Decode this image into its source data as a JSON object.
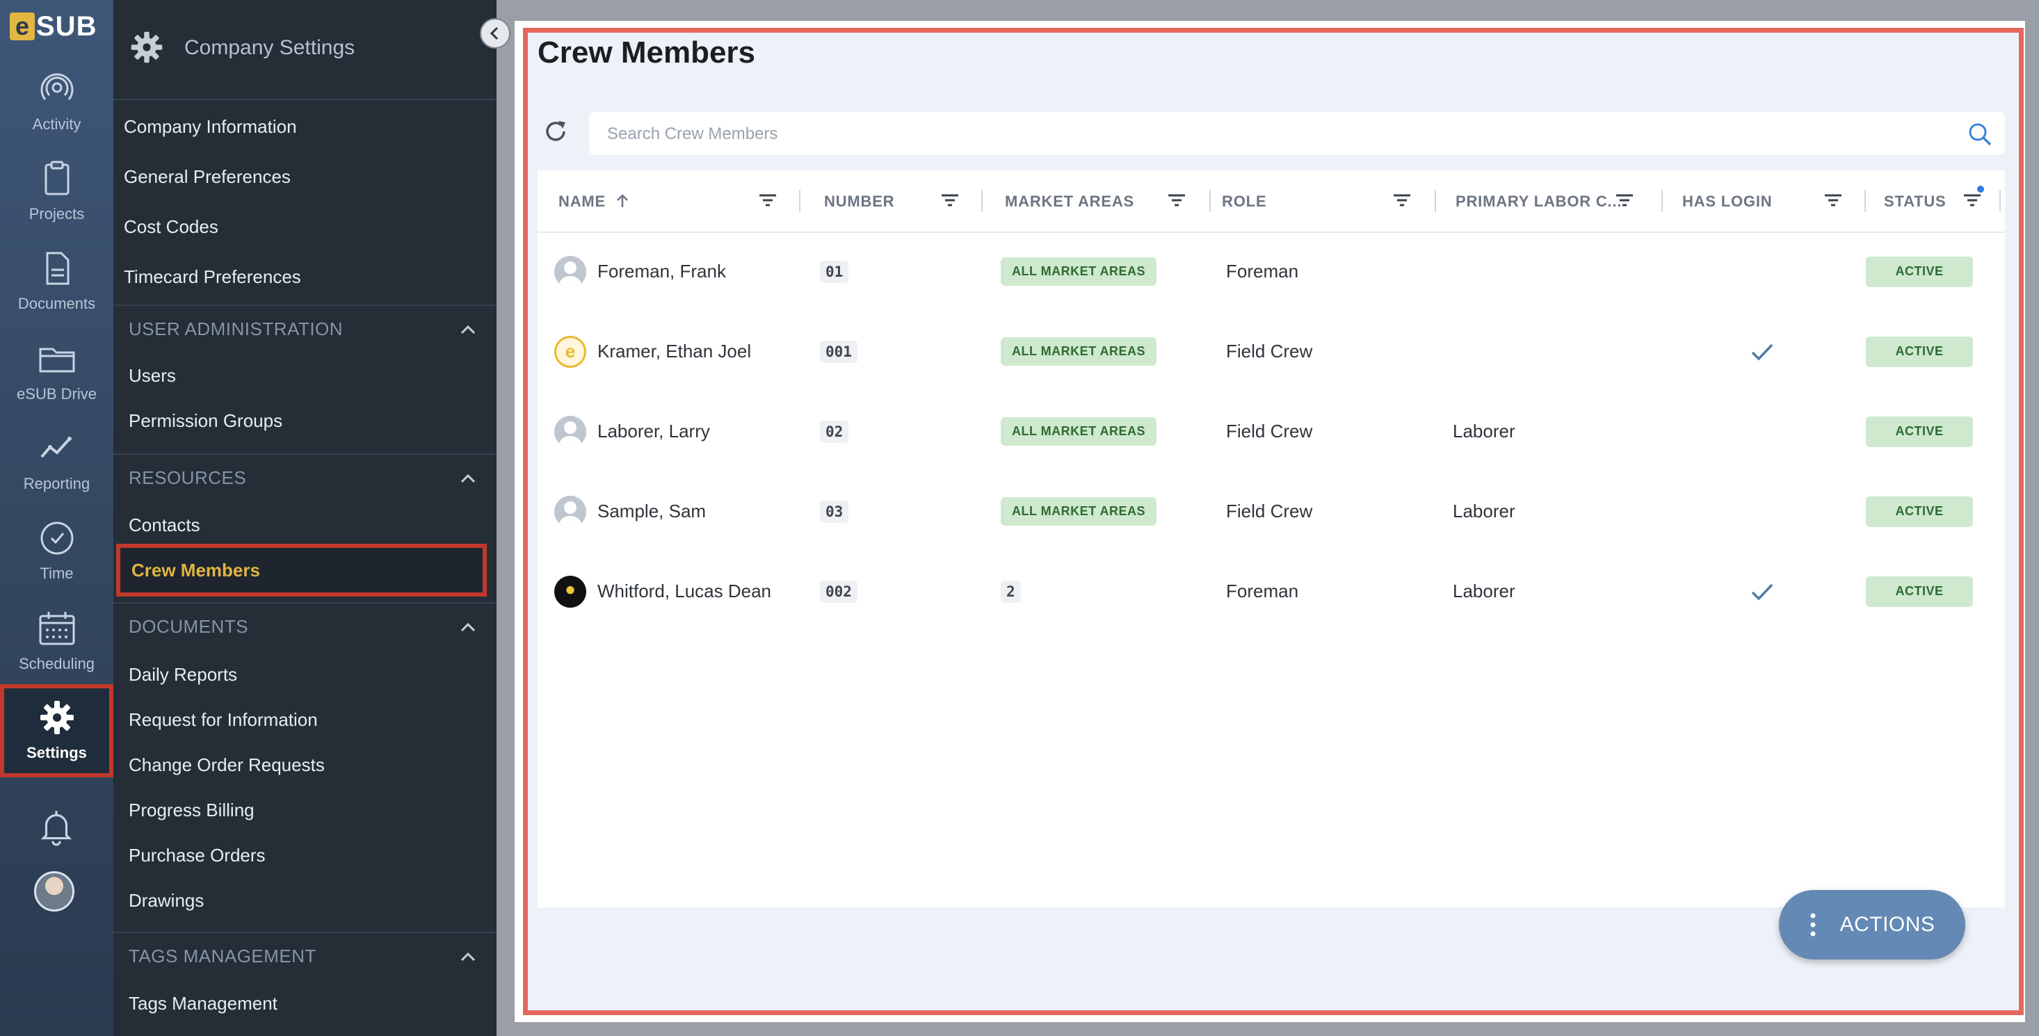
{
  "brand": {
    "logo_letter": "e",
    "logo_rest": "SUB"
  },
  "rail": {
    "items": [
      {
        "label": "Activity",
        "icon": "activity-icon"
      },
      {
        "label": "Projects",
        "icon": "clipboard-icon"
      },
      {
        "label": "Documents",
        "icon": "document-icon"
      },
      {
        "label": "eSUB Drive",
        "icon": "folder-icon"
      },
      {
        "label": "Reporting",
        "icon": "chart-icon"
      },
      {
        "label": "Time",
        "icon": "clock-icon"
      },
      {
        "label": "Scheduling",
        "icon": "calendar-icon"
      },
      {
        "label": "Settings",
        "icon": "gear-icon"
      }
    ],
    "active": "Settings"
  },
  "panel": {
    "title": "Company Settings",
    "top_links": [
      "Company Information",
      "General Preferences",
      "Cost Codes",
      "Timecard Preferences"
    ],
    "sections": [
      {
        "title": "USER ADMINISTRATION",
        "items": [
          "Users",
          "Permission Groups"
        ]
      },
      {
        "title": "RESOURCES",
        "items": [
          "Contacts",
          "Crew Members"
        ]
      },
      {
        "title": "DOCUMENTS",
        "items": [
          "Daily Reports",
          "Request for Information",
          "Change Order Requests",
          "Progress Billing",
          "Purchase Orders",
          "Drawings"
        ]
      },
      {
        "title": "TAGS MANAGEMENT",
        "items": [
          "Tags Management"
        ]
      }
    ],
    "active_item": "Crew Members"
  },
  "main": {
    "title": "Crew Members",
    "search_placeholder": "Search Crew Members",
    "columns": [
      "NAME",
      "NUMBER",
      "MARKET AREAS",
      "ROLE",
      "PRIMARY LABOR C...",
      "HAS LOGIN",
      "STATUS"
    ],
    "rows": [
      {
        "name": "Foreman, Frank",
        "number": "01",
        "market_areas": "ALL MARKET AREAS",
        "role": "Foreman",
        "labor": "",
        "has_login": false,
        "status": "ACTIVE",
        "avatar": "generic"
      },
      {
        "name": "Kramer, Ethan Joel",
        "number": "001",
        "market_areas": "ALL MARKET AREAS",
        "role": "Field Crew",
        "labor": "",
        "has_login": true,
        "status": "ACTIVE",
        "avatar": "esub"
      },
      {
        "name": "Laborer, Larry",
        "number": "02",
        "market_areas": "ALL MARKET AREAS",
        "role": "Field Crew",
        "labor": "Laborer",
        "has_login": false,
        "status": "ACTIVE",
        "avatar": "generic"
      },
      {
        "name": "Sample, Sam",
        "number": "03",
        "market_areas": "ALL MARKET AREAS",
        "role": "Field Crew",
        "labor": "Laborer",
        "has_login": false,
        "status": "ACTIVE",
        "avatar": "generic"
      },
      {
        "name": "Whitford, Lucas Dean",
        "number": "002",
        "market_areas": "2",
        "role": "Foreman",
        "labor": "Laborer",
        "has_login": true,
        "status": "ACTIVE",
        "avatar": "dark"
      }
    ],
    "actions_label": "ACTIONS"
  },
  "colors": {
    "accent": "#e0b441",
    "highlight": "#c0392b",
    "status_bg": "#cfe9cf",
    "status_text": "#2e6b32",
    "actions_bg": "#6489b5"
  }
}
